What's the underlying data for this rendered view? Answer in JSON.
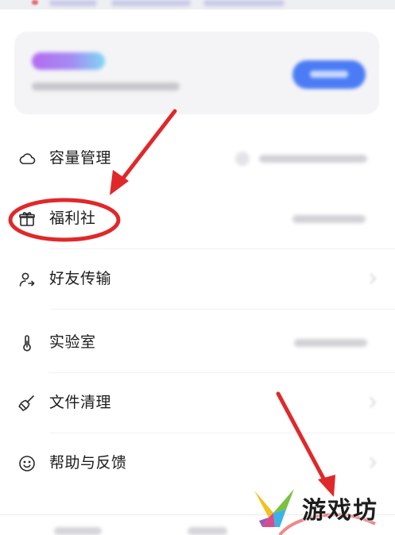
{
  "menu": {
    "items": [
      {
        "label": "容量管理",
        "icon": "cloud-icon"
      },
      {
        "label": "福利社",
        "icon": "gift-icon"
      },
      {
        "label": "好友传输",
        "icon": "friend-transfer-icon"
      },
      {
        "label": "实验室",
        "icon": "thermometer-icon"
      },
      {
        "label": "文件清理",
        "icon": "broom-icon"
      },
      {
        "label": "帮助与反馈",
        "icon": "smile-icon"
      }
    ]
  },
  "watermark": {
    "text": "游戏坊",
    "logo": "watermark-logo-icon"
  },
  "colors": {
    "annotation_red": "#e0282a",
    "promo_button": "#4b7cf5",
    "promo_gradient_start": "#b46bf0",
    "promo_gradient_end": "#7fd6f4"
  }
}
